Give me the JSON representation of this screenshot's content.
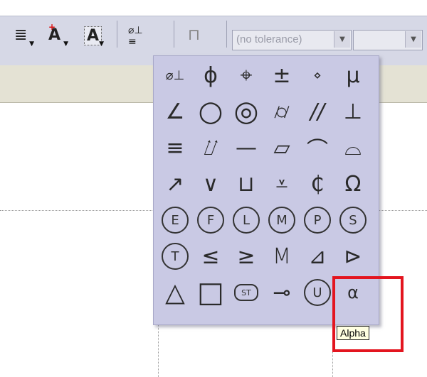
{
  "toolbar": {
    "tolerance_combo": {
      "value": "(no tolerance)"
    },
    "second_combo": {
      "value": ""
    },
    "buttons": [
      {
        "name": "text-justify-button"
      },
      {
        "name": "text-insert-button"
      },
      {
        "name": "text-frame-button"
      },
      {
        "name": "gdt-symbol-button"
      },
      {
        "name": "datum-button"
      }
    ]
  },
  "palette": {
    "symbols": [
      [
        "⌀⊥",
        "ϕ",
        "⌖",
        "±",
        "⋄",
        "μ"
      ],
      [
        "∠",
        "○",
        "◎",
        "⌭",
        "//",
        "⊥"
      ],
      [
        "≡",
        "⌰",
        "—",
        "▱",
        "⌒",
        "⌓"
      ],
      [
        "↗",
        "∨",
        "⊔",
        "⩡",
        "₵",
        "Ω"
      ],
      [
        "E",
        "F",
        "L",
        "M",
        "P",
        "S"
      ],
      [
        "T",
        "≤",
        "≥",
        "M",
        "⊿",
        "⊳"
      ],
      [
        "△",
        "□",
        "ST",
        "⊸",
        "U",
        "α"
      ]
    ]
  },
  "tooltip": {
    "text": "Alpha"
  }
}
